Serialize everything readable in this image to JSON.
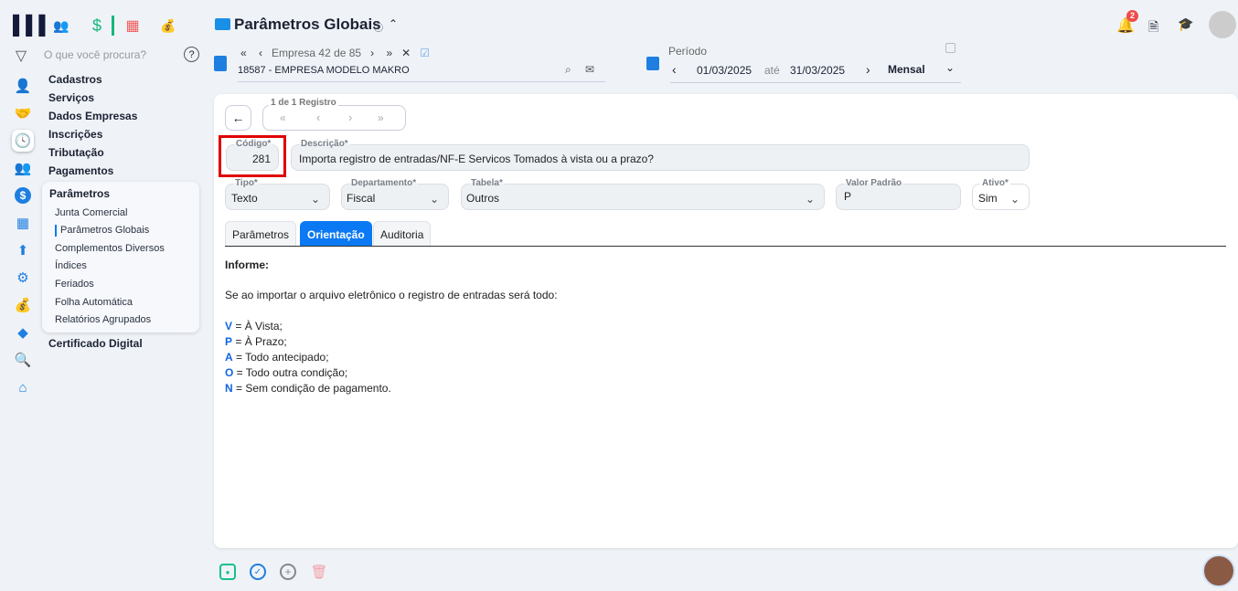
{
  "header": {
    "title": "Parâmetros Globais",
    "empresa_nav": "Empresa 42 de 85",
    "empresa": "18587 - EMPRESA MODELO MAKRO",
    "periodo_label": "Período",
    "date_from": "01/03/2025",
    "ate": "até",
    "date_to": "31/03/2025",
    "periodicidade": "Mensal",
    "notification_count": "2"
  },
  "sidebar": {
    "search_placeholder": "O que você procura?",
    "items": [
      "Cadastros",
      "Serviços",
      "Dados Empresas",
      "Inscrições",
      "Tributação",
      "Pagamentos"
    ],
    "submenu_title": "Parâmetros",
    "submenu": [
      "Junta Comercial",
      "Parâmetros Globais",
      "Complementos Diversos",
      "Índices",
      "Feriados",
      "Folha Automática",
      "Relatórios Agrupados"
    ],
    "after": "Certificado Digital"
  },
  "record": {
    "nav_label": "1 de 1 Registro"
  },
  "form": {
    "codigo_label": "Código*",
    "codigo": "281",
    "descricao_label": "Descrição*",
    "descricao": "Importa registro de entradas/NF-E Servicos Tomados à vista ou a prazo?",
    "tipo_label": "Tipo*",
    "tipo": "Texto",
    "departamento_label": "Departamento*",
    "departamento": "Fiscal",
    "tabela_label": "Tabela*",
    "tabela": "Outros",
    "valor_label": "Valor Padrão",
    "valor": "P",
    "ativo_label": "Ativo*",
    "ativo": "Sim"
  },
  "tabs": [
    "Parâmetros",
    "Orientação",
    "Auditoria"
  ],
  "orientacao": {
    "heading": "Informe:",
    "intro": "Se ao importar o arquivo eletrônico o registro de entradas será todo:",
    "options": [
      {
        "k": "V",
        "t": " = À Vista;"
      },
      {
        "k": "P",
        "t": " = À Prazo;"
      },
      {
        "k": "A",
        "t": " = Todo antecipado;"
      },
      {
        "k": "O",
        "t": " = Todo outra condição;"
      },
      {
        "k": "N",
        "t": " = Sem condição de pagamento."
      }
    ]
  },
  "colors": {
    "accent": "#0b79f3",
    "highlight": "#e00000"
  }
}
